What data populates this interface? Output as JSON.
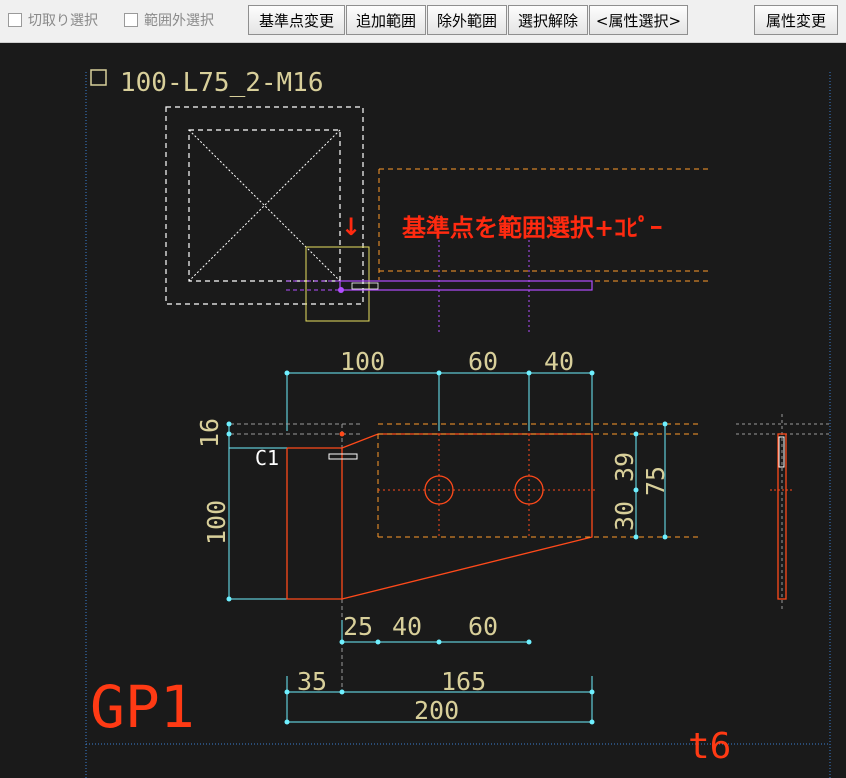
{
  "toolbar": {
    "checkboxes": [
      {
        "label": "切取り選択",
        "checked": false
      },
      {
        "label": "範囲外選択",
        "checked": false
      }
    ],
    "buttons": {
      "base_point": "基準点変更",
      "add_range": "追加範囲",
      "exclude_range": "除外範囲",
      "deselect": "選択解除",
      "attr_select": "<属性選択>",
      "attr_change": "属性変更"
    }
  },
  "drawing": {
    "part_name": "100-L75_2-M16",
    "instruction": "基準点を範囲選択+ｺﾋﾟｰ",
    "instruction_arrow": "↓",
    "mark": "GP1",
    "thickness": "t6",
    "hole_label": "C1",
    "top_dims": [
      "100",
      "60",
      "40"
    ],
    "left_dims": [
      "16",
      "100"
    ],
    "right_dims": [
      "39",
      "30",
      "75"
    ],
    "bottom_dims1": [
      "25",
      "40",
      "60"
    ],
    "bottom_dims2": [
      "35",
      "165"
    ],
    "total_dim": "200"
  },
  "colors": {
    "background": "#1a1a1a",
    "dimension_text": "#d8cf9a",
    "dimension_line": "#6ff0ff",
    "plate_outline": "#ff4a1a",
    "hidden_line": "#ff9a2a",
    "instruction_text": "#ff2a10",
    "section_line": "#b24dff"
  }
}
